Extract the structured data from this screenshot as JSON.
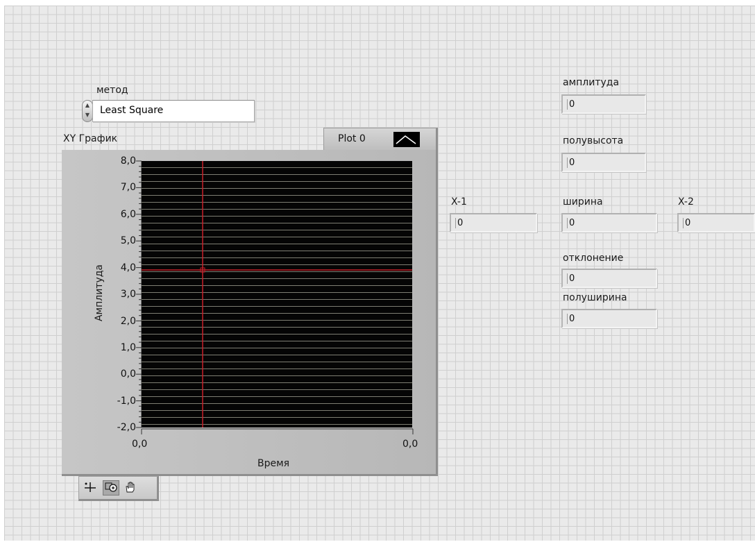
{
  "method": {
    "label": "метод",
    "value": "Least Square"
  },
  "graph": {
    "title": "XY График",
    "legend_label": "Plot 0",
    "y_axis_label": "Амплитуда",
    "x_axis_label": "Время",
    "y_ticks": [
      "8,0",
      "7,0",
      "6,0",
      "5,0",
      "4,0",
      "3,0",
      "2,0",
      "1,0",
      "0,0",
      "-1,0",
      "-2,0"
    ],
    "x_ticks": [
      "0,0",
      "0,0"
    ],
    "background": "#050505",
    "gridline_color": "#7e7e73",
    "cursor_color": "#c8202a"
  },
  "indicators": {
    "amplitude": {
      "label": "амплитуда",
      "value": "0"
    },
    "half_height": {
      "label": "полувысота",
      "value": "0"
    },
    "x1": {
      "label": "X-1",
      "value": "0"
    },
    "width": {
      "label": "ширина",
      "value": "0"
    },
    "x2": {
      "label": "X-2",
      "value": "0"
    },
    "deviation": {
      "label": "отклонение",
      "value": "0"
    },
    "half_width": {
      "label": "полуширина",
      "value": "0"
    }
  },
  "toolbar": {
    "icons": [
      "cursor-move-icon",
      "zoom-icon",
      "pan-hand-icon"
    ]
  }
}
